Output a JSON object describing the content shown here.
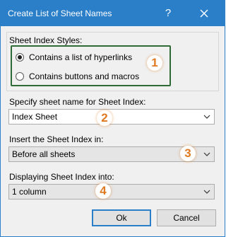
{
  "dialog": {
    "title": "Create List of Sheet Names",
    "help": "?",
    "close_icon": "close-icon"
  },
  "sheet_index_styles": {
    "group_label": "Sheet Index Styles:",
    "options": [
      {
        "label": "Contains a list of hyperlinks",
        "selected": true
      },
      {
        "label": "Contains buttons and macros",
        "selected": false
      }
    ]
  },
  "sheet_name": {
    "label": "Specify sheet name for Sheet Index:",
    "value": "Index Sheet"
  },
  "insert_in": {
    "label": "Insert the Sheet Index in:",
    "value": "Before all sheets"
  },
  "display_into": {
    "label": "Displaying Sheet Index into:",
    "value": "1 column"
  },
  "badges": [
    "1",
    "2",
    "3",
    "4"
  ],
  "buttons": {
    "ok": "Ok",
    "cancel": "Cancel"
  },
  "colors": {
    "titlebar": "#2b7fc9",
    "highlight_border": "#2e6b35",
    "badge_text": "#e07a20"
  }
}
